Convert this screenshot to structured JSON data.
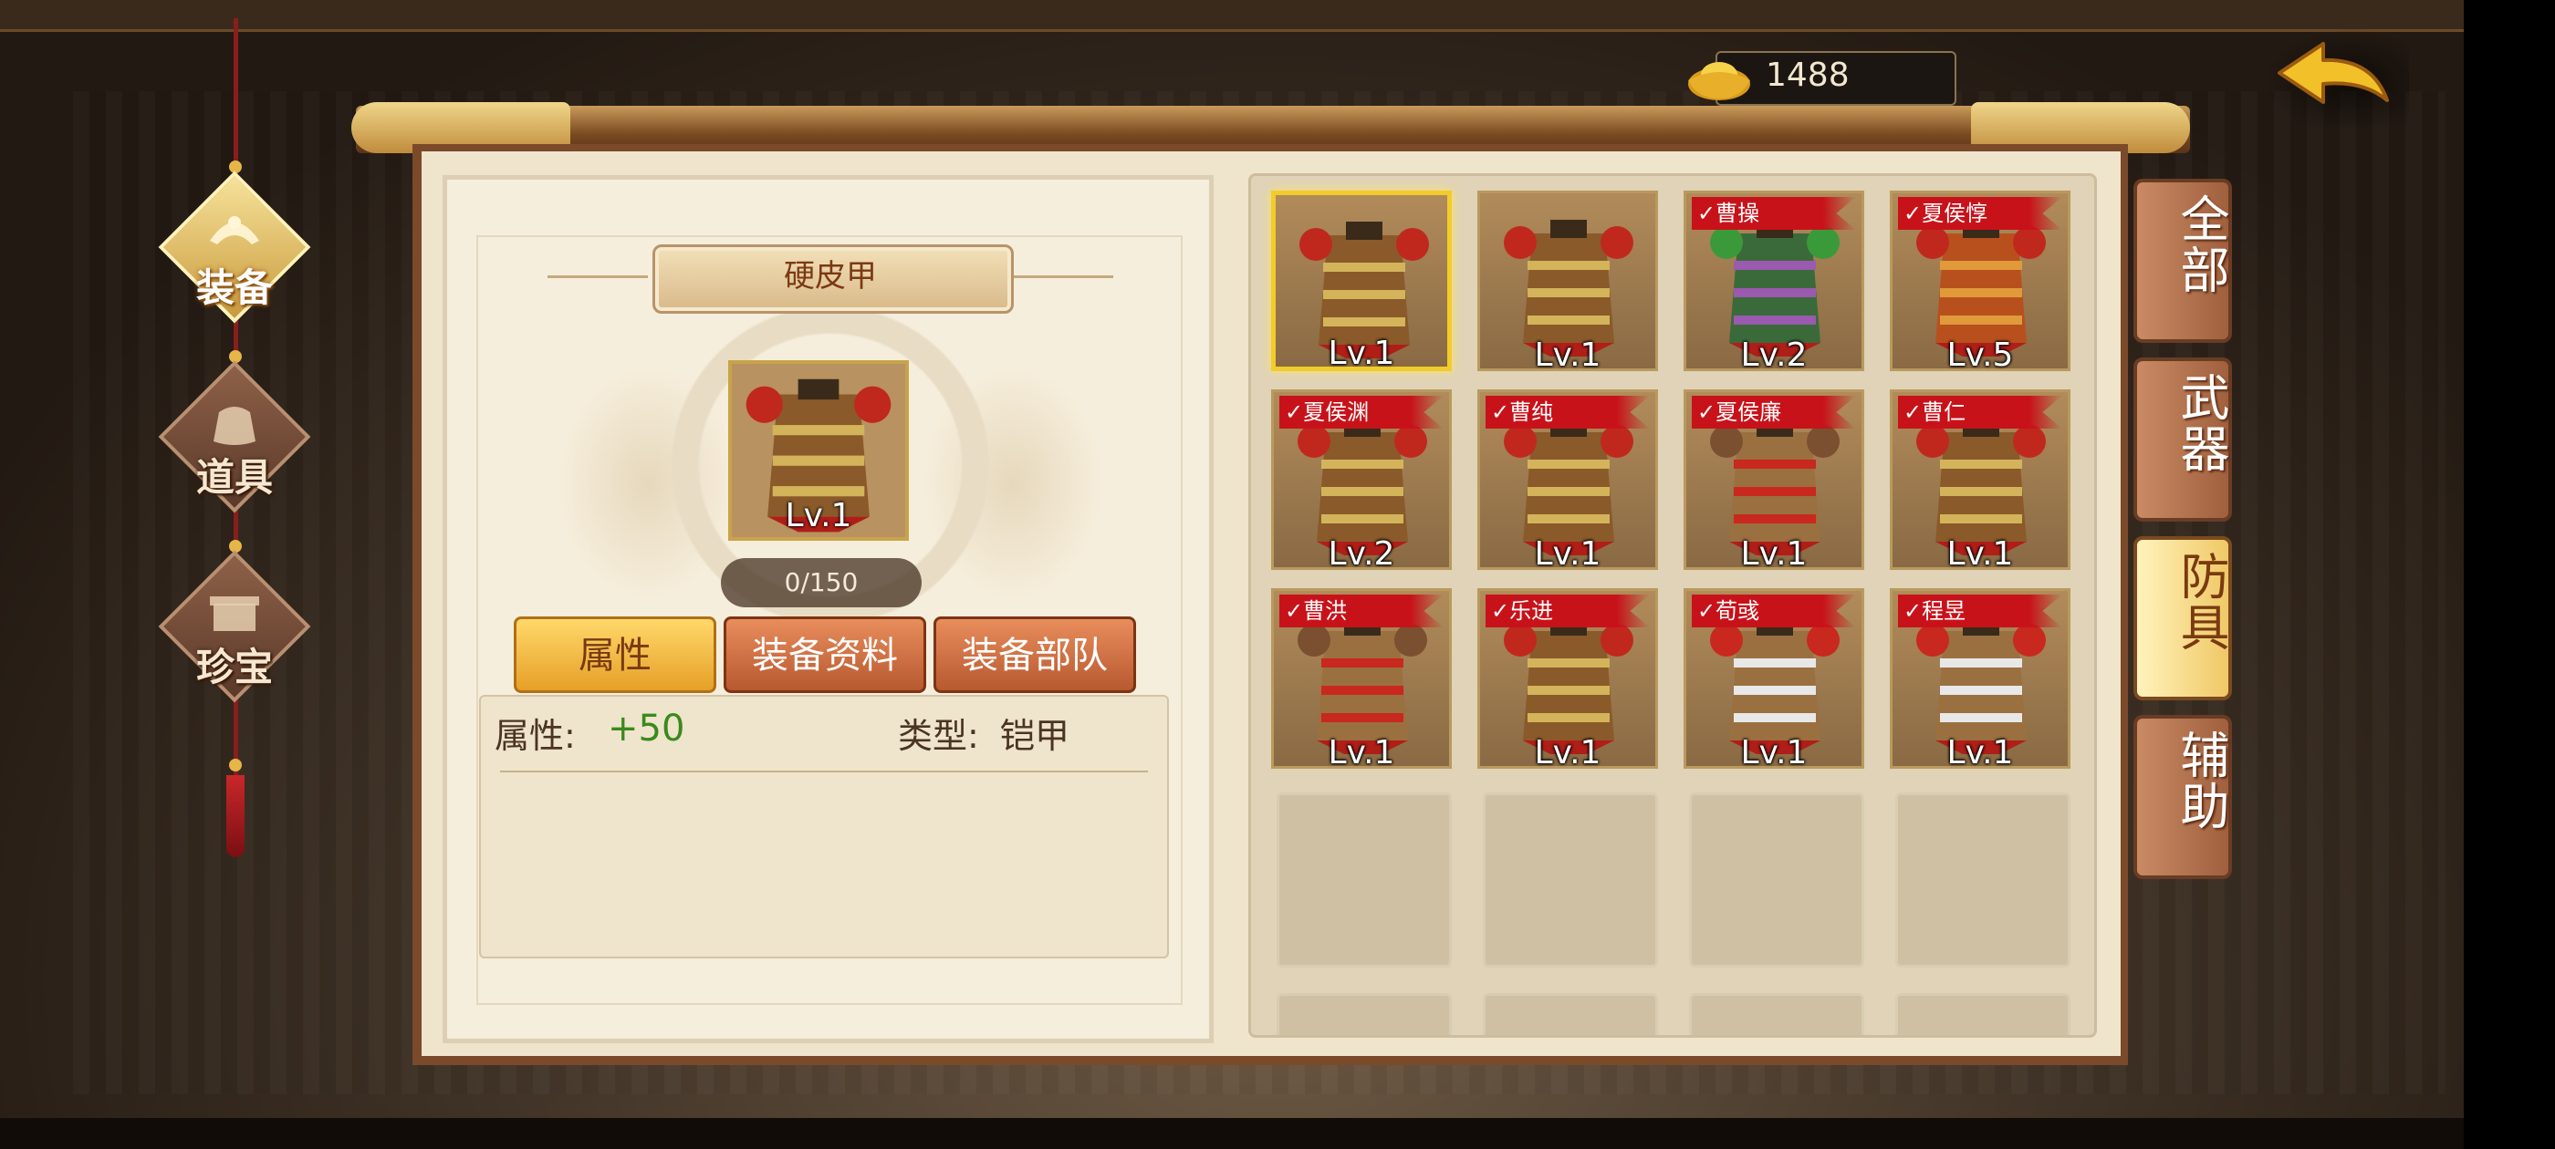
{
  "currency": {
    "value": "1488",
    "icon": "gold-ingot-icon"
  },
  "back_button": {
    "icon": "back-arrow-icon"
  },
  "nav": [
    {
      "label": "装备",
      "icon": "armor-helmet-icon",
      "active": true
    },
    {
      "label": "道具",
      "icon": "bag-icon",
      "active": false
    },
    {
      "label": "珍宝",
      "icon": "treasure-chest-icon",
      "active": false
    }
  ],
  "detail": {
    "title": "硬皮甲",
    "level": "Lv.1",
    "progress": "0/150",
    "tabs": [
      {
        "label": "属性",
        "active": true
      },
      {
        "label": "装备资料",
        "active": false
      },
      {
        "label": "装备部队",
        "active": false
      }
    ],
    "attr_label": "属性:",
    "attr_value": "+50",
    "type_label": "类型:",
    "type_value": "铠甲"
  },
  "items": [
    {
      "level": "Lv.1",
      "tag": "",
      "style": "brown",
      "selected": true
    },
    {
      "level": "Lv.1",
      "tag": "",
      "style": "brown",
      "selected": false
    },
    {
      "level": "Lv.2",
      "tag": "曹操",
      "style": "green",
      "selected": false
    },
    {
      "level": "Lv.5",
      "tag": "夏侯惇",
      "style": "orange",
      "selected": false
    },
    {
      "level": "Lv.2",
      "tag": "夏侯渊",
      "style": "brown",
      "selected": false
    },
    {
      "level": "Lv.1",
      "tag": "曹纯",
      "style": "brown",
      "selected": false
    },
    {
      "level": "Lv.1",
      "tag": "夏侯廉",
      "style": "robe",
      "selected": false
    },
    {
      "level": "Lv.1",
      "tag": "曹仁",
      "style": "brown",
      "selected": false
    },
    {
      "level": "Lv.1",
      "tag": "曹洪",
      "style": "robe",
      "selected": false
    },
    {
      "level": "Lv.1",
      "tag": "乐进",
      "style": "brown",
      "selected": false
    },
    {
      "level": "Lv.1",
      "tag": "荀彧",
      "style": "robe-white",
      "selected": false
    },
    {
      "level": "Lv.1",
      "tag": "程昱",
      "style": "robe-white",
      "selected": false
    }
  ],
  "check_mark": "✓",
  "side_tabs": [
    {
      "label": "全部",
      "active": false
    },
    {
      "label": "武器",
      "active": false
    },
    {
      "label": "防具",
      "active": true
    },
    {
      "label": "辅助",
      "active": false
    }
  ],
  "colors": {
    "accent": "#f2cc2a",
    "tag_red": "#c8121a",
    "attr_green": "#3a8a1c"
  }
}
